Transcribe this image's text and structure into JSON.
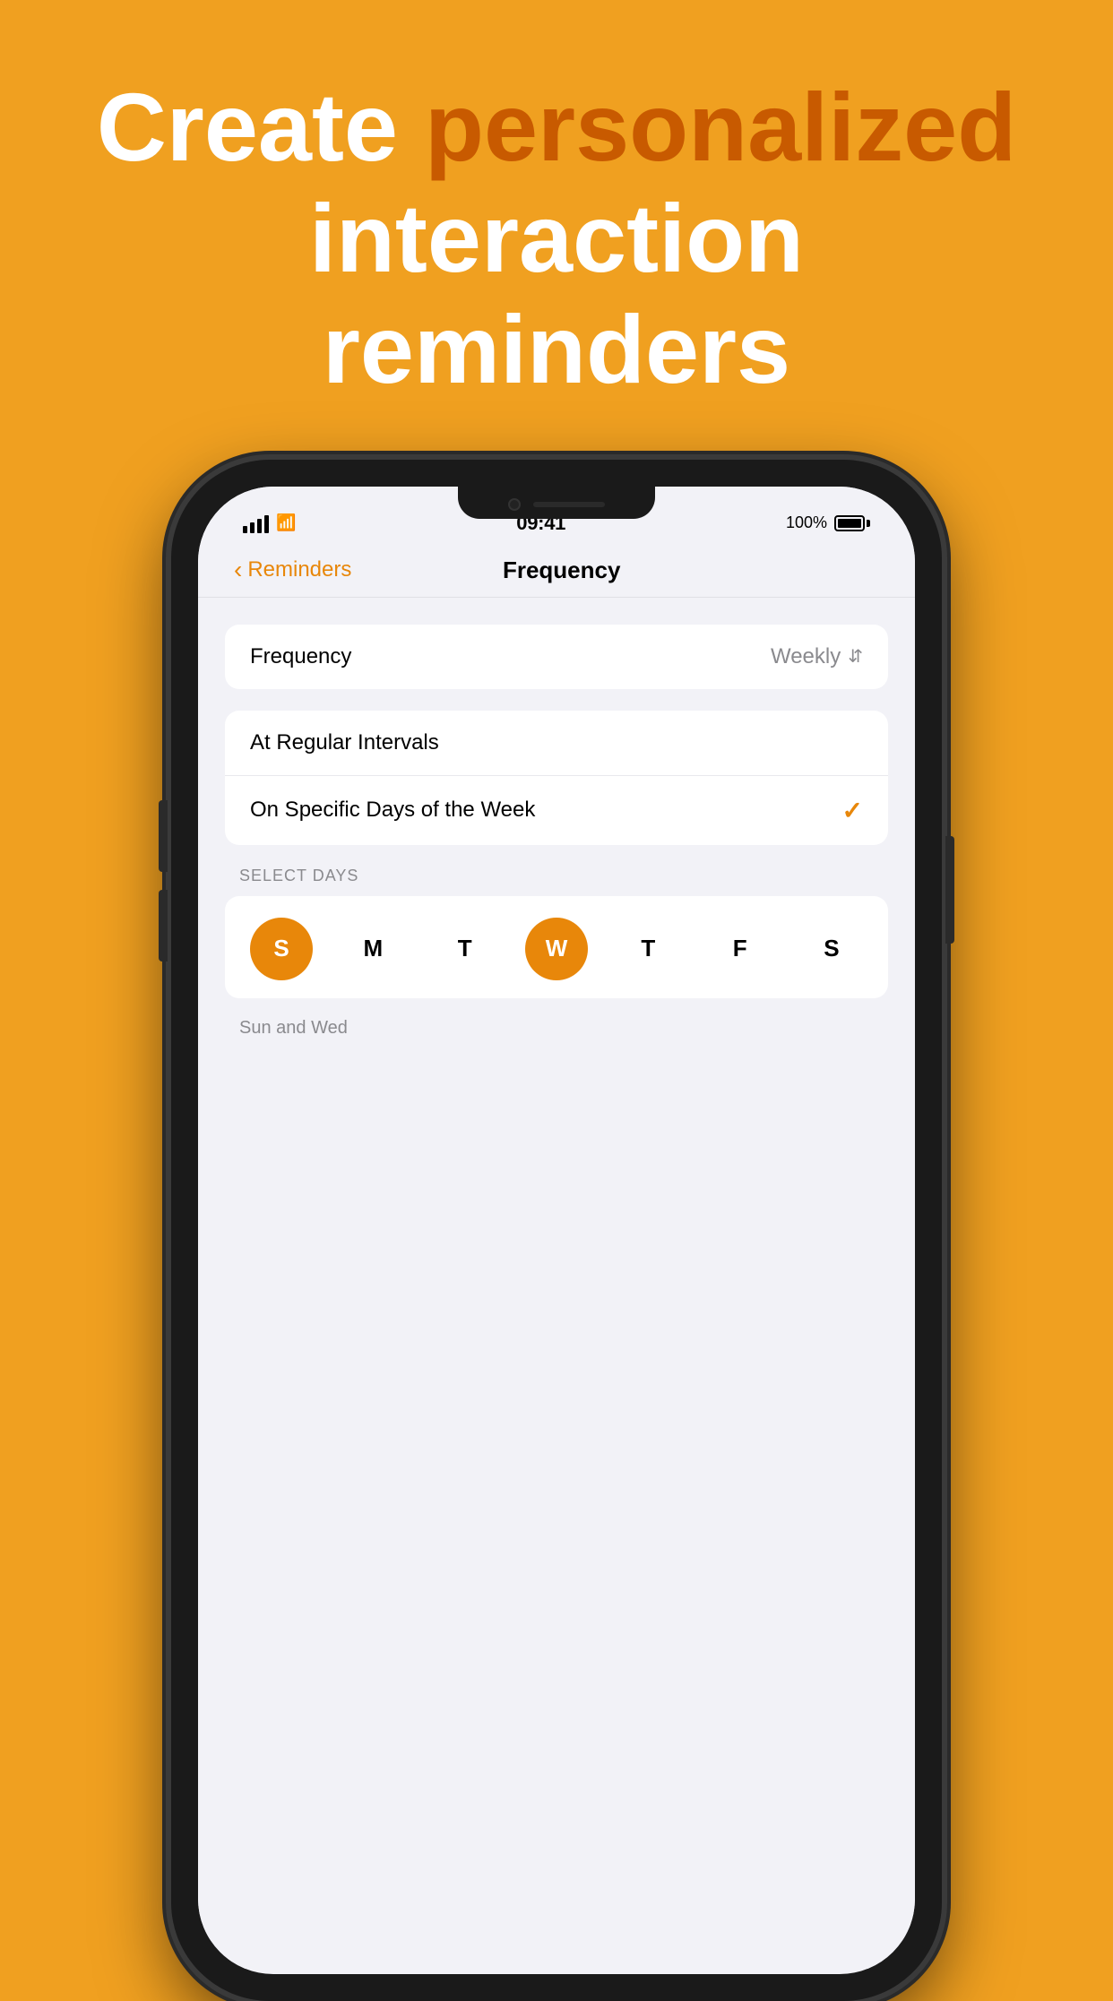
{
  "header": {
    "line1_normal": "Create ",
    "line1_highlight": "personalized",
    "line2": "interaction reminders"
  },
  "status_bar": {
    "time": "09:41",
    "battery_percent": "100%"
  },
  "nav": {
    "back_label": "Reminders",
    "title": "Frequency"
  },
  "frequency_card": {
    "label": "Frequency",
    "value": "Weekly"
  },
  "options": [
    {
      "label": "At Regular Intervals",
      "checked": false
    },
    {
      "label": "On Specific Days of the Week",
      "checked": true
    }
  ],
  "select_days_header": "SELECT DAYS",
  "days": [
    {
      "letter": "S",
      "key": "sun",
      "selected": true
    },
    {
      "letter": "M",
      "key": "mon",
      "selected": false
    },
    {
      "letter": "T",
      "key": "tue",
      "selected": false
    },
    {
      "letter": "W",
      "key": "wed",
      "selected": true
    },
    {
      "letter": "T",
      "key": "thu",
      "selected": false
    },
    {
      "letter": "F",
      "key": "fri",
      "selected": false
    },
    {
      "letter": "S",
      "key": "sat",
      "selected": false
    }
  ],
  "days_subtitle": "Sun and Wed",
  "colors": {
    "accent": "#E8870A",
    "background": "#F0A020",
    "highlight_text": "#C85A00"
  }
}
